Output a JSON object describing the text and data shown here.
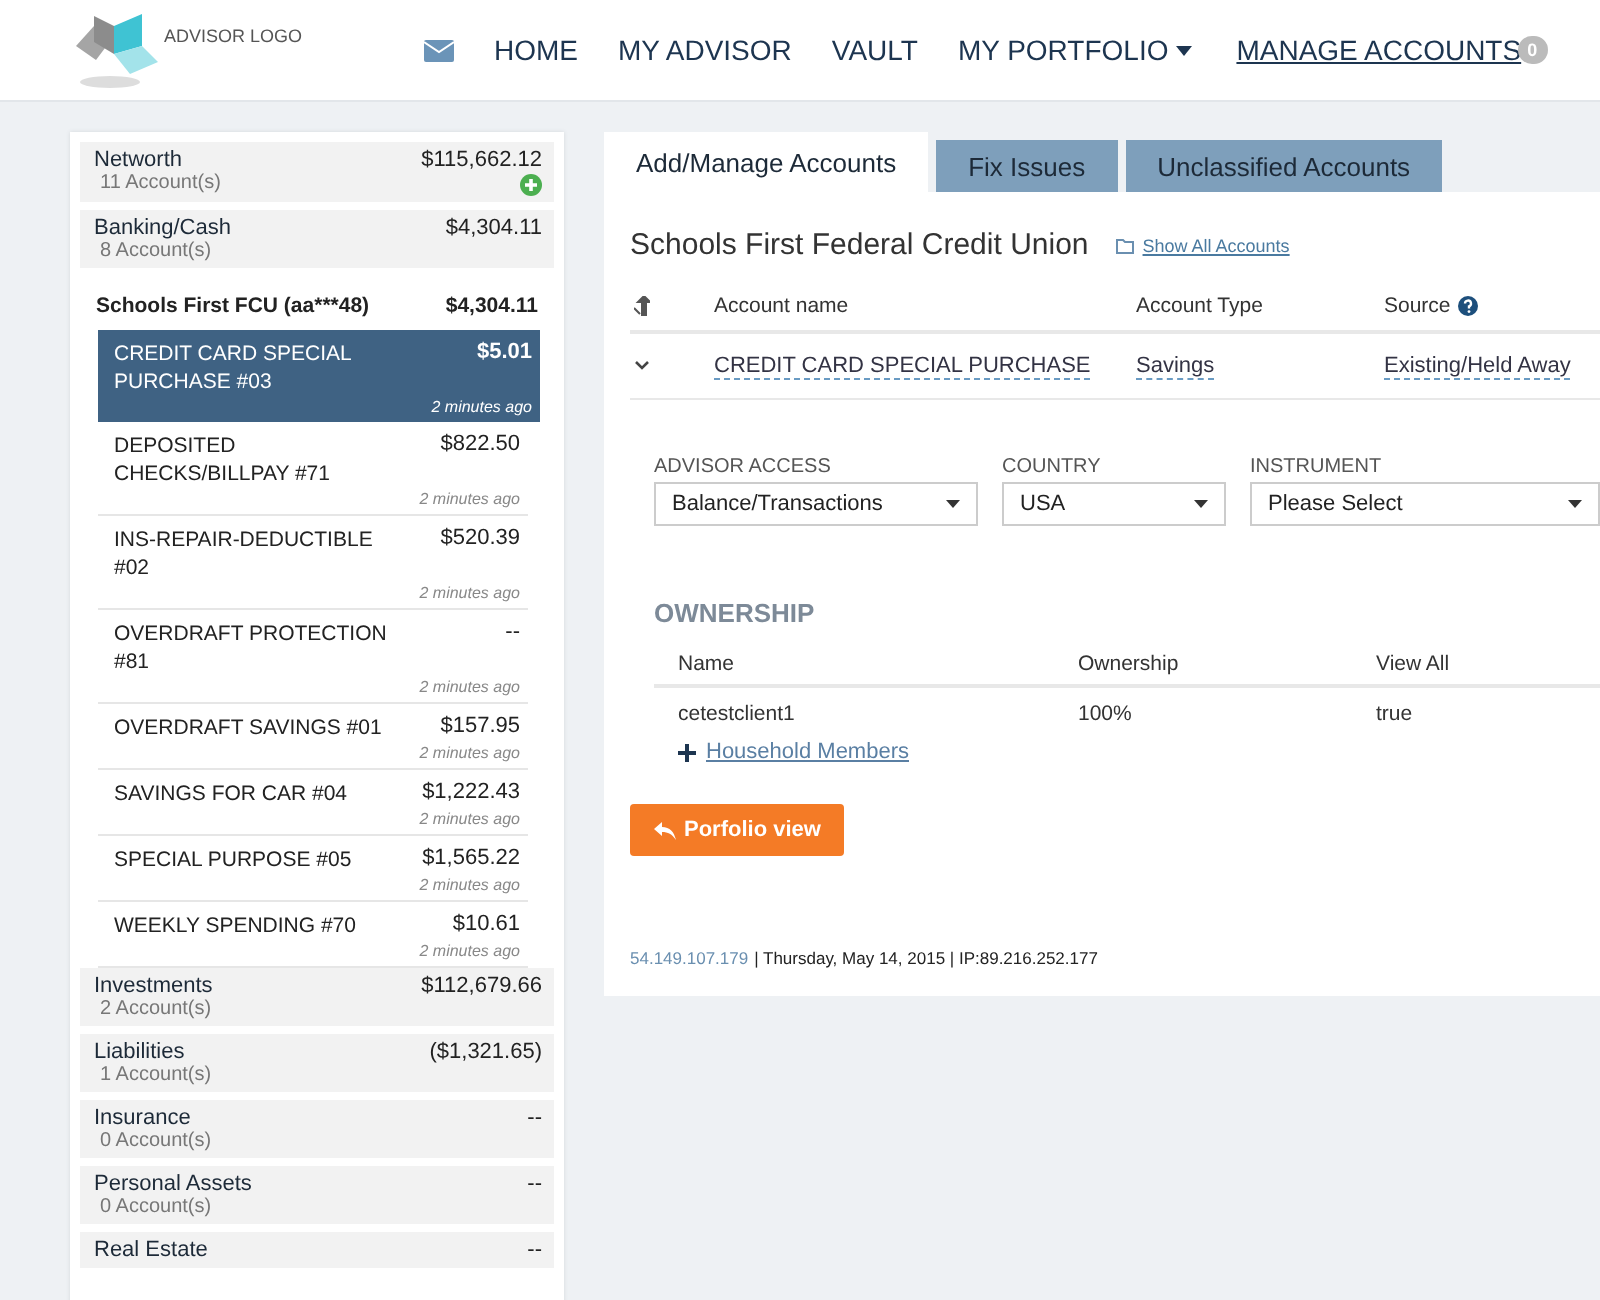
{
  "header": {
    "logo": "ADVISOR LOGO",
    "nav": [
      {
        "kind": "icon",
        "selected": false
      },
      {
        "kind": "link",
        "label": "HOME",
        "selected": false
      },
      {
        "kind": "link",
        "label": "MY ADVISOR",
        "selected": false
      },
      {
        "kind": "link",
        "label": "VAULT",
        "selected": false
      },
      {
        "kind": "dropdown",
        "label": "MY PORTFOLIO",
        "selected": false
      },
      {
        "kind": "link",
        "label": "MANAGE ACCOUNTS",
        "badge": "0",
        "selected": true
      }
    ]
  },
  "sidebar": {
    "categories": [
      {
        "kind": "total",
        "name": "Networth",
        "count": "11 Account(s)",
        "amount": "$115,662.12"
      },
      {
        "kind": "category",
        "name": "Banking/Cash",
        "count": "8 Account(s)",
        "amount": "$4,304.11",
        "institution": {
          "name": "Schools First FCU (aa***48)",
          "amount": "$4,304.11",
          "accounts": [
            {
              "name": "CREDIT CARD SPECIAL PURCHASE #03",
              "amount": "$5.01",
              "time": "2 minutes ago",
              "selected": true
            },
            {
              "name": "DEPOSITED CHECKS/BILLPAY #71",
              "amount": "$822.50",
              "time": "2 minutes ago",
              "selected": false
            },
            {
              "name": "INS-REPAIR-DEDUCTIBLE #02",
              "amount": "$520.39",
              "time": "2 minutes ago",
              "selected": false
            },
            {
              "name": "OVERDRAFT PROTECTION #81",
              "amount": "--",
              "time": "2 minutes ago",
              "selected": false
            },
            {
              "name": "OVERDRAFT SAVINGS #01",
              "amount": "$157.95",
              "time": "2 minutes ago",
              "selected": false
            },
            {
              "name": "SAVINGS FOR CAR #04",
              "amount": "$1,222.43",
              "time": "2 minutes ago",
              "selected": false
            },
            {
              "name": "SPECIAL PURPOSE #05",
              "amount": "$1,565.22",
              "time": "2 minutes ago",
              "selected": false
            },
            {
              "name": "WEEKLY SPENDING #70",
              "amount": "$10.61",
              "time": "2 minutes ago",
              "selected": false
            }
          ]
        }
      },
      {
        "kind": "category",
        "name": "Investments",
        "count": "2 Account(s)",
        "amount": "$112,679.66"
      },
      {
        "kind": "category",
        "name": "Liabilities",
        "count": "1 Account(s)",
        "amount": "($1,321.65)"
      },
      {
        "kind": "category",
        "name": "Insurance",
        "count": "0 Account(s)",
        "amount": "--"
      },
      {
        "kind": "category",
        "name": "Personal Assets",
        "count": "0 Account(s)",
        "amount": "--"
      },
      {
        "kind": "category",
        "name": "Real Estate",
        "amount": "--"
      }
    ]
  },
  "tabs": [
    {
      "label": "Add/Manage Accounts",
      "selected": true
    },
    {
      "label": "Fix Issues",
      "selected": false
    },
    {
      "label": "Unclassified Accounts",
      "selected": false
    }
  ],
  "institution": {
    "title": "Schools First Federal Credit Union",
    "link": "Show All Accounts"
  },
  "accounts_table": {
    "columns": [
      "Account name",
      "Account Type",
      "Source"
    ],
    "rows": [
      {
        "name": "CREDIT CARD SPECIAL PURCHASE",
        "type": "Savings",
        "source": "Existing/Held Away",
        "expanded": true
      }
    ]
  },
  "fields": [
    {
      "label": "ADVISOR ACCESS",
      "value": "Balance/Transactions"
    },
    {
      "label": "COUNTRY",
      "value": "USA"
    },
    {
      "label": "INSTRUMENT",
      "value": "Please Select"
    }
  ],
  "ownership": {
    "title": "OWNERSHIP",
    "columns": [
      "Name",
      "Ownership",
      "View All"
    ],
    "rows": [
      [
        "cetestclient1",
        "100%",
        "true"
      ]
    ],
    "add_link": "Household Members"
  },
  "action_button": "Porfolio view",
  "footer": {
    "server": "54.149.107.179",
    "info": "| Thursday, May 14, 2015 | IP:89.216.252.177"
  }
}
